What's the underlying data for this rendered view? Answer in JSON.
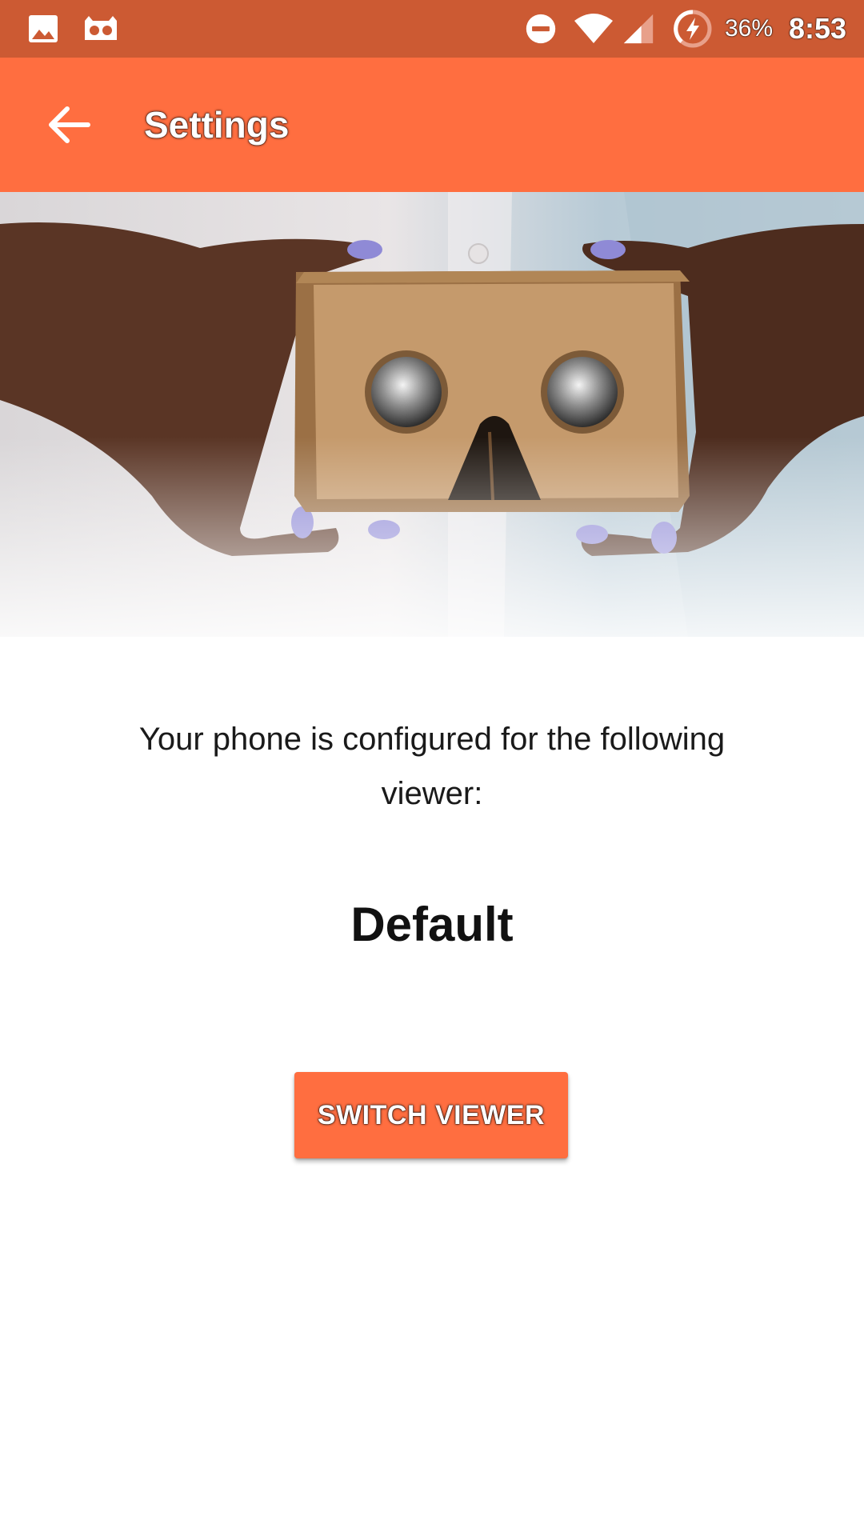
{
  "status_bar": {
    "battery_text": "36%",
    "time": "8:53",
    "background_color": "#cc5a33",
    "icons": [
      "image-icon",
      "cardboard-notification-icon",
      "do-not-disturb-icon",
      "wifi-icon",
      "cell-signal-icon",
      "battery-charging-icon"
    ]
  },
  "app_bar": {
    "title": "Settings",
    "back_icon": "arrow-back-icon",
    "background_color": "#ff6e40"
  },
  "hero": {
    "subject": "cardboard-vr-viewer-photo"
  },
  "content": {
    "description": "Your phone is configured for the following viewer:",
    "viewer_name": "Default",
    "switch_button_label": "SWITCH VIEWER",
    "accent_color": "#ff6e40"
  }
}
